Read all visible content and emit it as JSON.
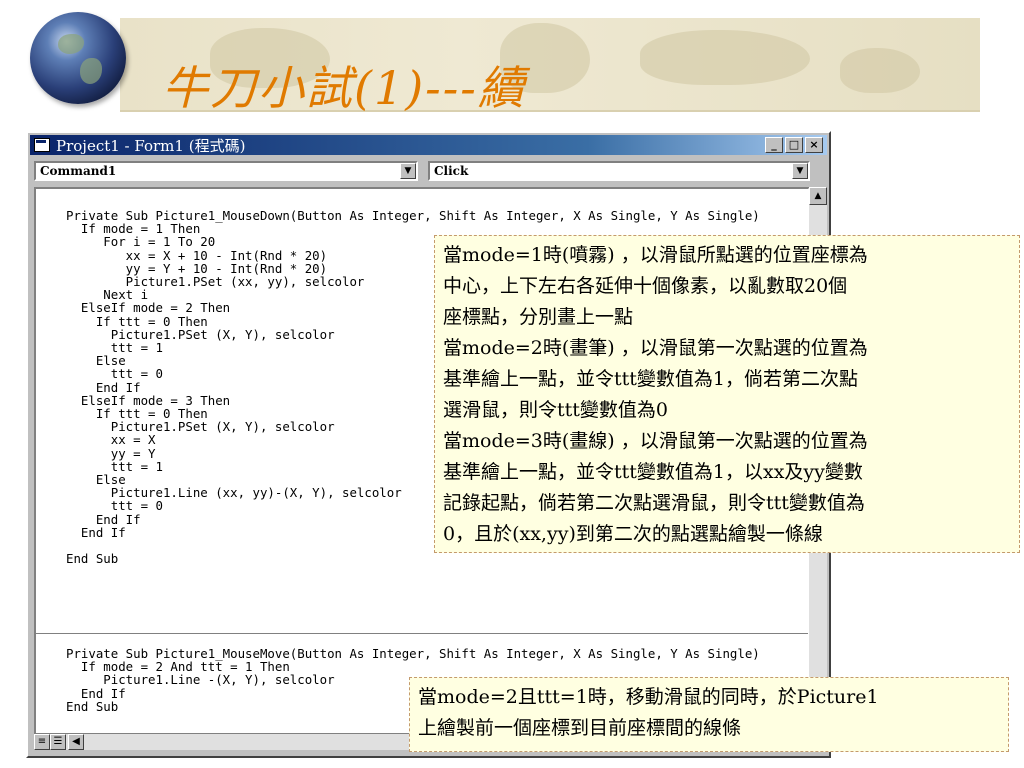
{
  "slide": {
    "title": "牛刀小試(1)---續"
  },
  "window": {
    "title": "Project1 - Form1 (程式碼)",
    "buttons": {
      "minimize": "_",
      "maximize": "□",
      "close": "×"
    },
    "object_combo": "Command1",
    "procedure_combo": "Click"
  },
  "code": {
    "mousedown_lines": [
      "Private Sub Picture1_MouseDown(Button As Integer, Shift As Integer, X As Single, Y As Single)",
      "  If mode = 1 Then",
      "     For i = 1 To 20",
      "        xx = X + 10 - Int(Rnd * 20)",
      "        yy = Y + 10 - Int(Rnd * 20)",
      "        Picture1.PSet (xx, yy), selcolor",
      "     Next i",
      "  ElseIf mode = 2 Then",
      "    If ttt = 0 Then",
      "      Picture1.PSet (X, Y), selcolor",
      "      ttt = 1",
      "    Else",
      "      ttt = 0",
      "    End If",
      "  ElseIf mode = 3 Then",
      "    If ttt = 0 Then",
      "      Picture1.PSet (X, Y), selcolor",
      "      xx = X",
      "      yy = Y",
      "      ttt = 1",
      "    Else",
      "      Picture1.Line (xx, yy)-(X, Y), selcolor",
      "      ttt = 0",
      "    End If",
      "  End If",
      "",
      "End Sub"
    ],
    "mousemove_lines": [
      "Private Sub Picture1_MouseMove(Button As Integer, Shift As Integer, X As Single, Y As Single)",
      "  If mode = 2 And ttt = 1 Then",
      "     Picture1.Line -(X, Y), selcolor",
      "  End If",
      "End Sub"
    ]
  },
  "callouts": {
    "main_lines": [
      "當mode=1時(噴霧) ，以滑鼠所點選的位置座標為",
      "中心，上下左右各延伸十個像素，以亂數取20個",
      "座標點，分別畫上一點",
      "當mode=2時(畫筆) ，以滑鼠第一次點選的位置為",
      "基準繪上一點，並令ttt變數值為1，倘若第二次點",
      "選滑鼠，則令ttt變數值為0",
      "當mode=3時(畫線) ，以滑鼠第一次點選的位置為",
      "基準繪上一點，並令ttt變數值為1，以xx及yy變數",
      "記錄起點，倘若第二次點選滑鼠，則令ttt變數值為",
      "0，且於(xx,yy)到第二次的點選點繪製一條線"
    ],
    "mousemove_lines": [
      "當mode=2且ttt=1時，移動滑鼠的同時，於Picture1",
      "上繪製前一個座標到目前座標間的線條"
    ]
  },
  "colors": {
    "title": "#e07a00",
    "titlebar": "#0a246a",
    "callout_bg": "#ffffe1",
    "callout_border": "#c49a6c"
  }
}
